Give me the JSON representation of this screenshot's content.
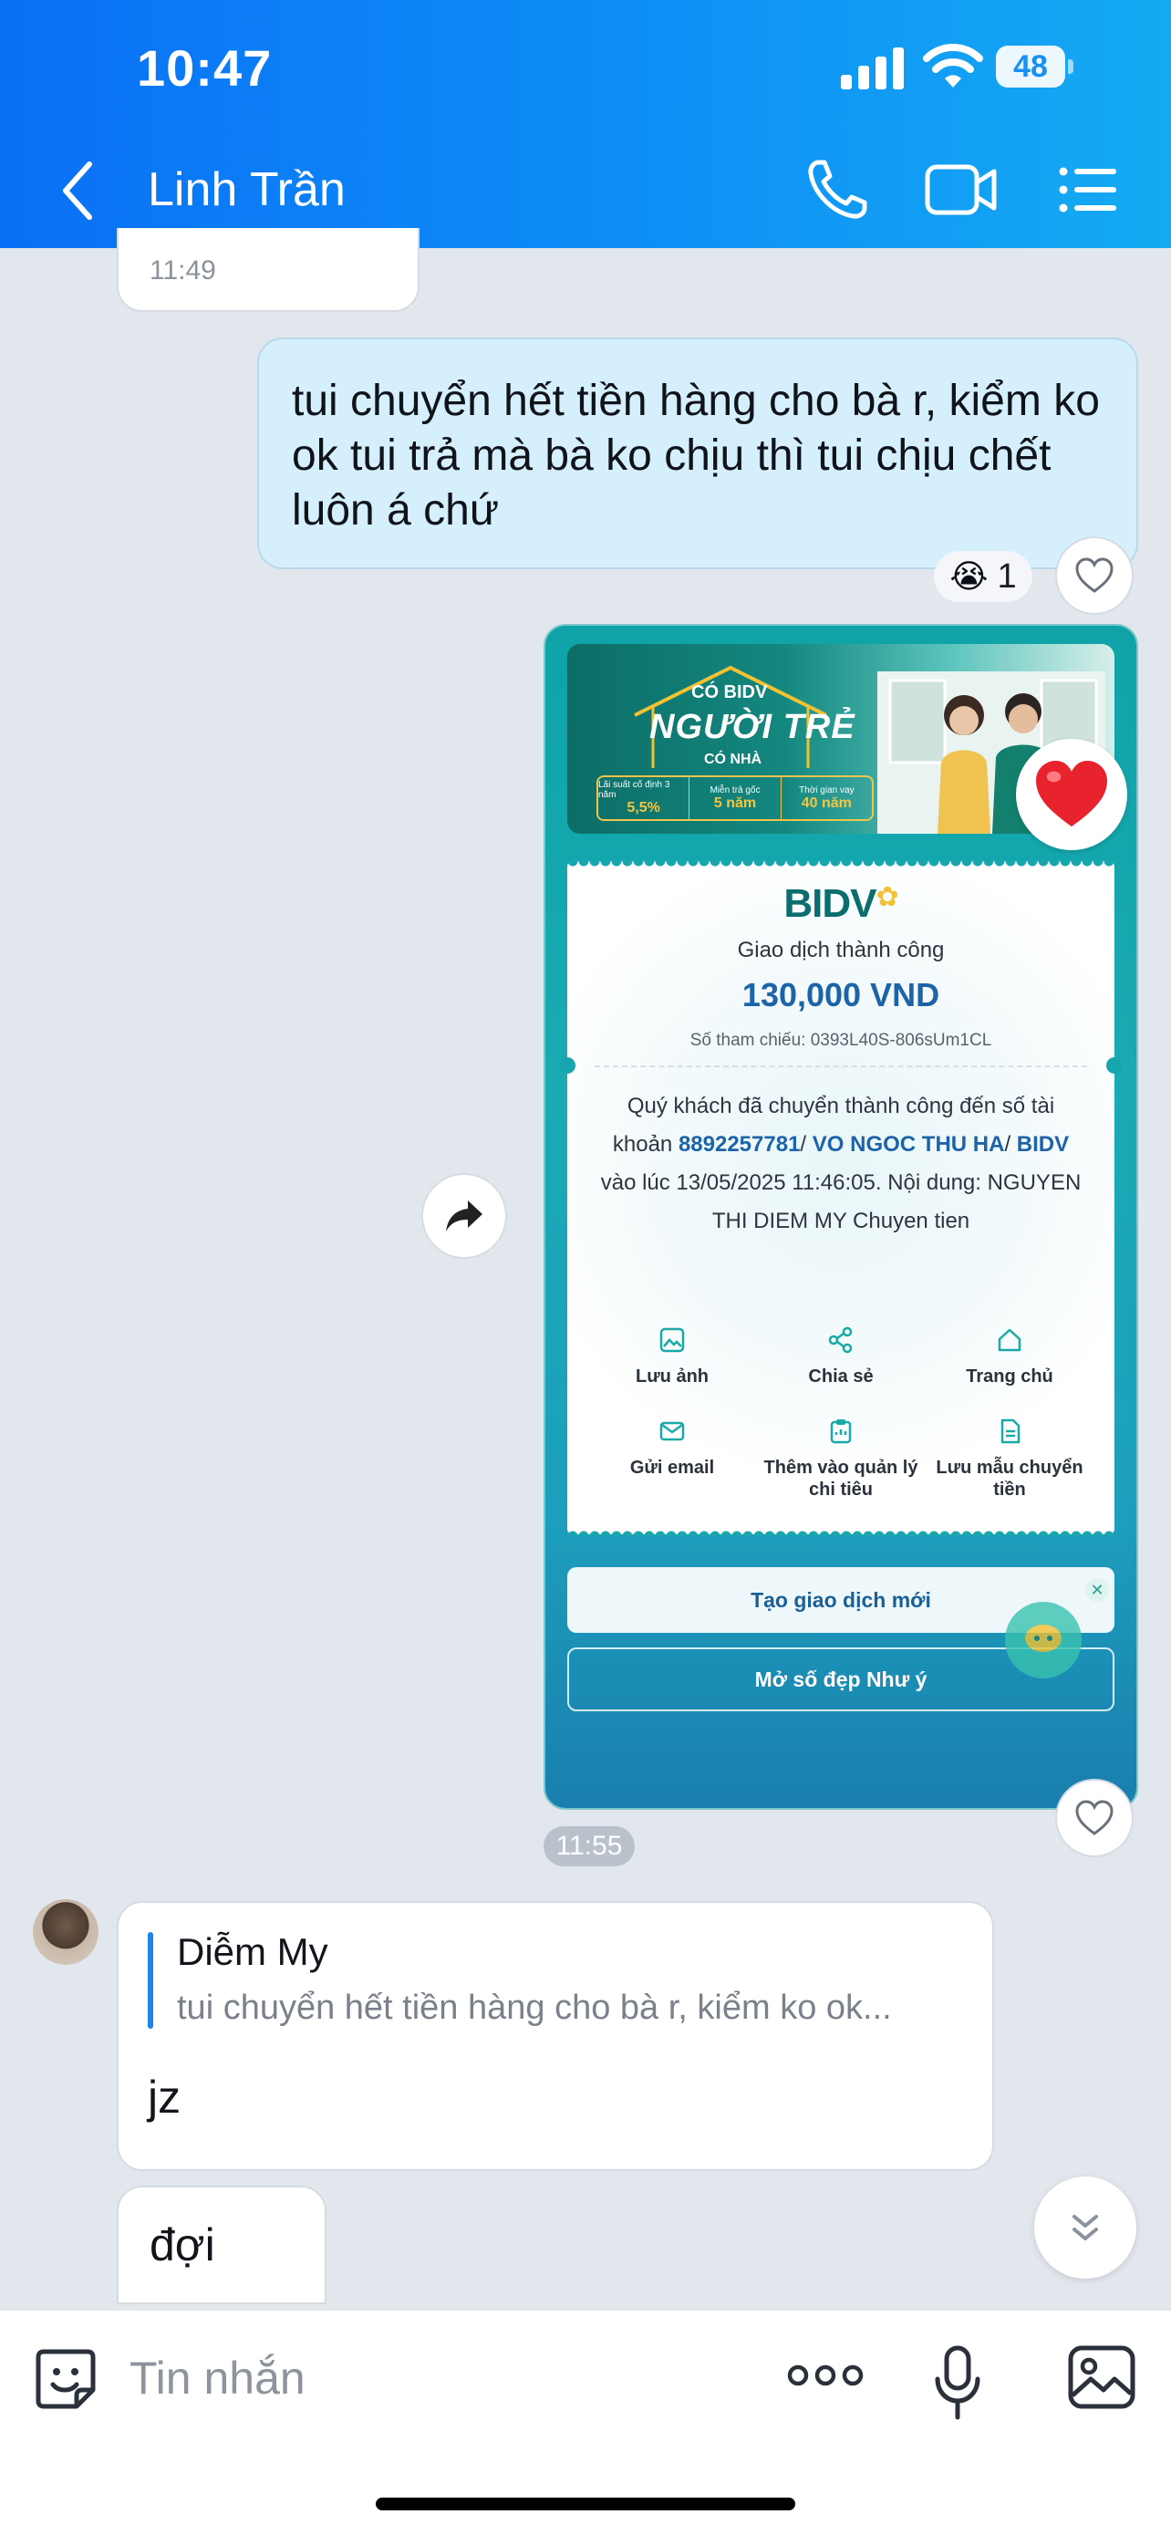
{
  "status_bar": {
    "time": "10:47",
    "battery": "48"
  },
  "header": {
    "contact_name": "Linh Trần"
  },
  "messages": {
    "prev_time": "11:49",
    "outgoing_text": "tui chuyển hết tiền hàng cho bà r, kiểm ko ok tui trả mà bà ko chịu thì tui chịu chết luôn á chứ",
    "reaction_emoji": "😭",
    "reaction_count": "1",
    "image_time": "11:55",
    "reply_quote_name": "Diễm My",
    "reply_quote_text": "tui chuyển hết tiền hàng cho bà r, kiểm ko ok...",
    "reply_text": "jz",
    "last_text": "đợi"
  },
  "receipt_image": {
    "banner_top": "CÓ BIDV",
    "banner_big": "NGƯỜI TRẺ",
    "banner_sub": "CÓ NHÀ",
    "banner_cells": [
      {
        "k": "Lãi suất cố định 3 năm",
        "v": "5,5%"
      },
      {
        "k": "Miễn trả gốc",
        "v": "5 năm"
      },
      {
        "k": "Thời gian vay",
        "v": "40 năm"
      }
    ],
    "logo": "BIDV",
    "status": "Giao dịch thành công",
    "amount": "130,000 VND",
    "reference": "Số tham chiếu: 0393L40S-806sUm1CL",
    "desc_1": "Quý khách đã chuyển thành công đến số tài khoản ",
    "account": "8892257781",
    "sep_1": "/ ",
    "recipient": "VO NGOC THU HA",
    "sep_2": "/ ",
    "bank": "BIDV",
    "desc_2": " vào lúc 13/05/2025 11:46:05. Nội dung: NGUYEN THI DIEM MY Chuyen tien",
    "actions": {
      "save_image": "Lưu ảnh",
      "share": "Chia sẻ",
      "home": "Trang chủ",
      "send_email": "Gửi email",
      "add_expense": "Thêm vào quản lý chi tiêu",
      "save_template": "Lưu mẫu chuyển tiền"
    },
    "btn_new": "Tạo giao dịch mới",
    "btn_number": "Mở số đẹp Như ý"
  },
  "composer": {
    "placeholder": "Tin nhắn"
  },
  "colors": {
    "header_start": "#0a70f5",
    "header_end": "#15aaf2",
    "outgoing_bubble": "#d5f0fc",
    "accent": "#1b84f0",
    "heart": "#e8232e"
  },
  "icons": [
    "back-icon",
    "phone-icon",
    "video-icon",
    "menu-icon",
    "heart-icon",
    "forward-icon",
    "chevron-down-icon",
    "sticker-icon",
    "more-icon",
    "mic-icon",
    "gallery-icon"
  ]
}
